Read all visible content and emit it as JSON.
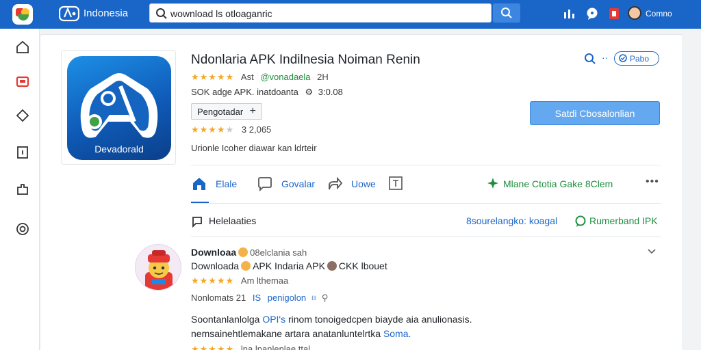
{
  "topbar": {
    "brand": "Indonesia",
    "search_value": "wownload ls otloaganric",
    "user_name": "Comno",
    "colors": {
      "bar": "#1a66c8",
      "search_button": "#3c86e0"
    }
  },
  "rail": {
    "items": [
      "home-outline-icon",
      "folder-red-icon",
      "diamond-outline-icon",
      "document-icon",
      "puzzle-icon",
      "target-icon"
    ]
  },
  "app": {
    "icon_label": "Devadorald",
    "title": "Ndonlaria APK Indilnesia Noiman Renin",
    "rating_stars": "★★★★★",
    "rating_prefix": "Ast",
    "developer": "@vonadaela",
    "rating_suffix": "2H",
    "meta_line": "SOK adge APK. inatdoanta",
    "meta_version": "3:0.08",
    "tag_label": "Pengotadar",
    "tag_plus": "+",
    "score_stars": "★★★★",
    "score_half": "★",
    "score_count": "3 2,065",
    "description": "Urionle Icoher diawar kan ldrteir",
    "pill_label": "Pabo",
    "install_label": "Satdi Cbosalonlian"
  },
  "tabs": [
    {
      "label": "Elale",
      "icon": "home-filled-icon"
    },
    {
      "label": "Govalar",
      "icon": "chat-bubble-icon"
    },
    {
      "label": "Uowe",
      "icon": "share-icon"
    },
    {
      "label": "",
      "icon": "text-box-icon"
    }
  ],
  "tab_right": "Mlane Ctotia Gake  8Clem",
  "highlights": {
    "label": "Helelaaties",
    "link_blue": "8sourelangko: koagal",
    "link_green": "Rumerband IPK"
  },
  "review": {
    "line1_a": "Downloaa",
    "line1_b": "08elclania sah",
    "line2_a": "Downloada",
    "line2_b": "APK Indaria APK",
    "line2_c": "CKK lbouet",
    "stars": "★★★★★",
    "stars_label": "Am lthemaa",
    "meta_a": "Nonlomats 21",
    "meta_b": "IS",
    "meta_c": "penigolon",
    "body1_a": "Soontanlanlolga",
    "body1_b": "OPI's",
    "body1_c": "rinom tonoigedcpen biayde aia anulionasis.",
    "body2_a": "nemsainehtlemakane artara anatanluntelrtka",
    "body2_b": "Soma.",
    "last_stars": "★★★★★",
    "last_text": "lna  lnanlenlae ttal"
  }
}
